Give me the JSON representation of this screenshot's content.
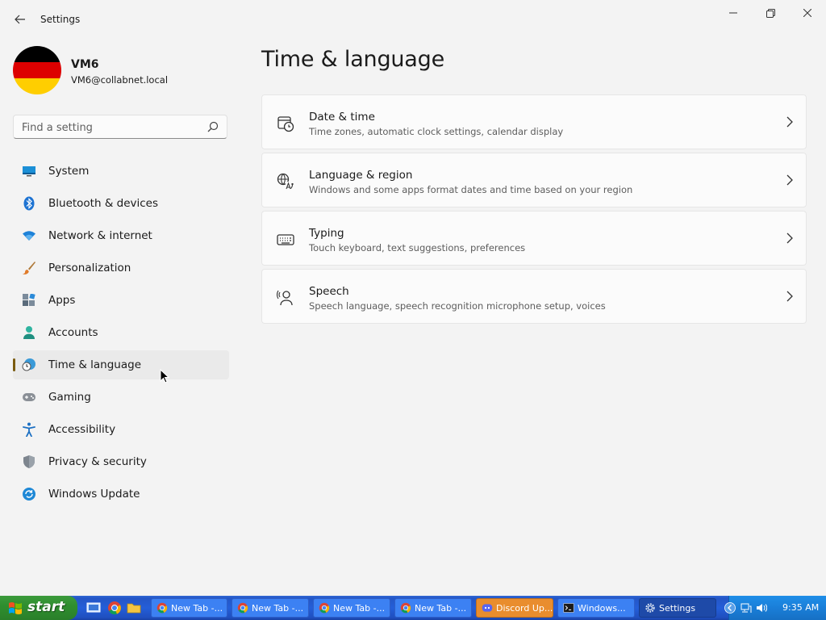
{
  "window": {
    "title": "Settings"
  },
  "account": {
    "name": "VM6",
    "email": "VM6@collabnet.local"
  },
  "search": {
    "placeholder": "Find a setting"
  },
  "nav": {
    "items": [
      {
        "label": "System",
        "icon": "display-icon"
      },
      {
        "label": "Bluetooth & devices",
        "icon": "bluetooth-icon"
      },
      {
        "label": "Network & internet",
        "icon": "wifi-icon"
      },
      {
        "label": "Personalization",
        "icon": "brush-icon"
      },
      {
        "label": "Apps",
        "icon": "apps-icon"
      },
      {
        "label": "Accounts",
        "icon": "person-icon"
      },
      {
        "label": "Time & language",
        "icon": "globe-clock-icon",
        "active": true
      },
      {
        "label": "Gaming",
        "icon": "gamepad-icon"
      },
      {
        "label": "Accessibility",
        "icon": "accessibility-icon"
      },
      {
        "label": "Privacy & security",
        "icon": "shield-icon"
      },
      {
        "label": "Windows Update",
        "icon": "update-icon"
      }
    ]
  },
  "main": {
    "title": "Time & language",
    "cards": [
      {
        "title": "Date & time",
        "description": "Time zones, automatic clock settings, calendar display",
        "icon": "calendar-clock-icon"
      },
      {
        "title": "Language & region",
        "description": "Windows and some apps format dates and time based on your region",
        "icon": "language-icon"
      },
      {
        "title": "Typing",
        "description": "Touch keyboard, text suggestions, preferences",
        "icon": "keyboard-icon"
      },
      {
        "title": "Speech",
        "description": "Speech language, speech recognition microphone setup, voices",
        "icon": "speech-icon"
      }
    ]
  },
  "taskbar": {
    "start_label": "start",
    "buttons": [
      {
        "label": "New Tab -..."
      },
      {
        "label": "New Tab -..."
      },
      {
        "label": "New Tab -..."
      },
      {
        "label": "New Tab -..."
      },
      {
        "label": "Discord Up..."
      },
      {
        "label": "Windows..."
      },
      {
        "label": "Settings"
      }
    ],
    "clock": "9:35 AM"
  },
  "colors": {
    "accent": "#7a5b0f",
    "taskbar": "#245ed8",
    "start": "#2f8f2f",
    "tray": "#1a7ed8"
  }
}
